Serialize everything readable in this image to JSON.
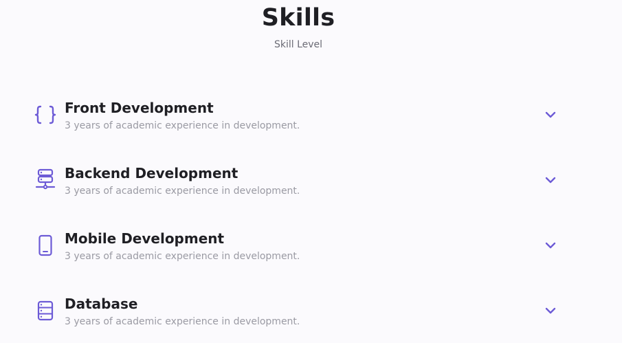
{
  "header": {
    "title": "Skills",
    "subtitle": "Skill Level"
  },
  "skills": [
    {
      "name": "Front Development",
      "description": "3 years of academic experience in development.",
      "icon": "braces-icon"
    },
    {
      "name": "Backend Development",
      "description": "3 years of academic experience in development.",
      "icon": "server-icon"
    },
    {
      "name": "Mobile Development",
      "description": "3 years of academic experience in development.",
      "icon": "smartphone-icon"
    },
    {
      "name": "Database",
      "description": "3 years of academic experience in development.",
      "icon": "database-icon"
    }
  ],
  "colors": {
    "accent": "#6c5ad6",
    "background": "#fbfafd",
    "title_text": "#1f1f24",
    "muted_text": "#9a9aa3"
  }
}
